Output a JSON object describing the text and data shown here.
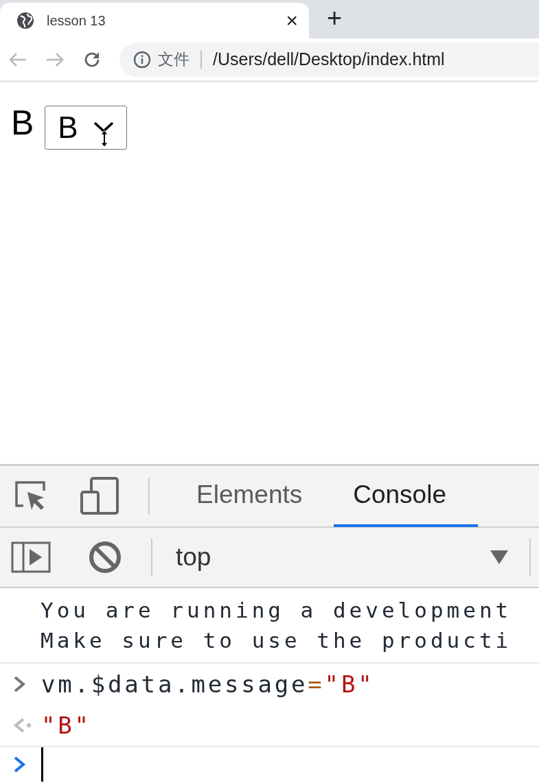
{
  "browser_tab": {
    "title": "lesson 13",
    "close": "×",
    "new_tab": "+"
  },
  "address_bar": {
    "scheme_label": "文件",
    "url": "/Users/dell/Desktop/index.html"
  },
  "page": {
    "message": "B",
    "select": {
      "value": "B"
    }
  },
  "devtools": {
    "tabs": [
      {
        "label": "Elements",
        "selected": false
      },
      {
        "label": "Console",
        "selected": true
      }
    ],
    "context": "top",
    "console": [
      {
        "kind": "warning",
        "lines": [
          "You are running a development",
          "Make sure to use the producti"
        ]
      },
      {
        "kind": "input",
        "parts": [
          {
            "kind": "name",
            "text": "vm.$data.message"
          },
          {
            "kind": "operator",
            "text": "="
          },
          {
            "kind": "string",
            "text": "\"B\""
          }
        ]
      },
      {
        "kind": "result",
        "parts": [
          {
            "kind": "string",
            "text": "\"B\""
          }
        ]
      }
    ]
  }
}
